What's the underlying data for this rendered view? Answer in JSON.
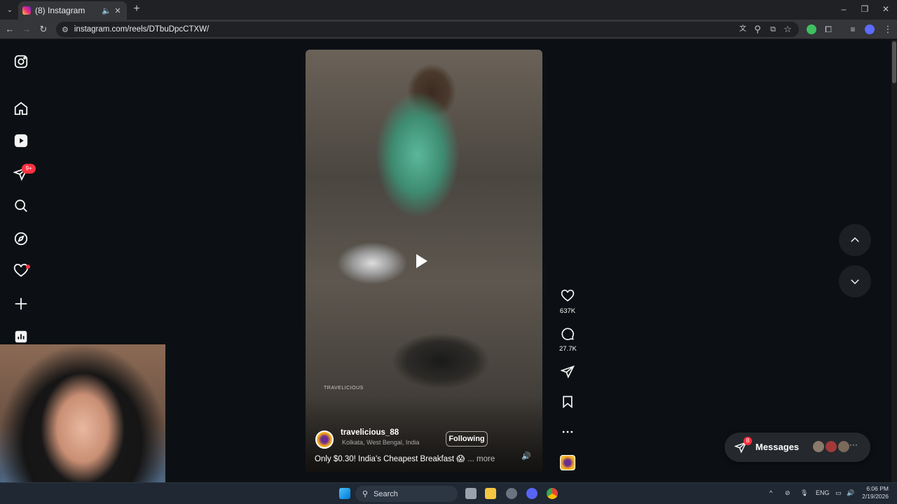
{
  "browser": {
    "tab_title": "(8) Instagram",
    "url": "instagram.com/reels/DTbuDpcCTXW/"
  },
  "sidebar": {
    "items": [
      {
        "name": "instagram-logo"
      },
      {
        "name": "home"
      },
      {
        "name": "reels"
      },
      {
        "name": "messages",
        "badge": "9+"
      },
      {
        "name": "search"
      },
      {
        "name": "explore"
      },
      {
        "name": "notifications"
      },
      {
        "name": "create"
      },
      {
        "name": "dashboard"
      }
    ]
  },
  "reel": {
    "watermark": "TRAVELICIOUS",
    "username": "travelicious_88",
    "location": "Kolkata, West Bengal, India",
    "follow_label": "Following",
    "caption": "Only $0.30! India's Cheapest Breakfast 😱",
    "more_label": "... more"
  },
  "actions": {
    "likes": "637K",
    "comments": "27.7K"
  },
  "messages": {
    "label": "Messages",
    "badge": "8"
  },
  "taskbar": {
    "search_placeholder": "Search",
    "lang": "ENG",
    "time": "6:06 PM",
    "date": "2/19/2026"
  },
  "colors": {
    "page_bg": "#0c1014",
    "notification_red": "#ff3040",
    "chrome_bg": "#202124"
  }
}
